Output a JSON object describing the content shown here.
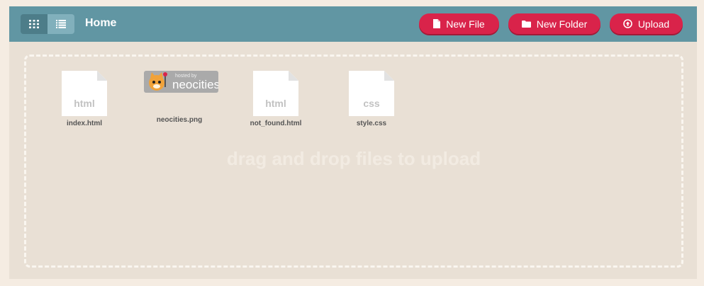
{
  "toolbar": {
    "view_grid_icon": "grid-icon",
    "view_list_icon": "list-icon",
    "title": "Home",
    "buttons": {
      "new_file": "New File",
      "new_folder": "New Folder",
      "upload": "Upload"
    }
  },
  "files": [
    {
      "name": "index.html",
      "type": "html"
    },
    {
      "name": "neocities.png",
      "type": "image",
      "badge_small": "hosted by",
      "badge_big": "neocities"
    },
    {
      "name": "not_found.html",
      "type": "html"
    },
    {
      "name": "style.css",
      "type": "css"
    }
  ],
  "dropzone": {
    "text": "drag and drop files to upload"
  },
  "colors": {
    "toolbar": "#6196a3",
    "accent": "#d9234a",
    "panel": "#e9e0d5",
    "page": "#f5ece2"
  }
}
